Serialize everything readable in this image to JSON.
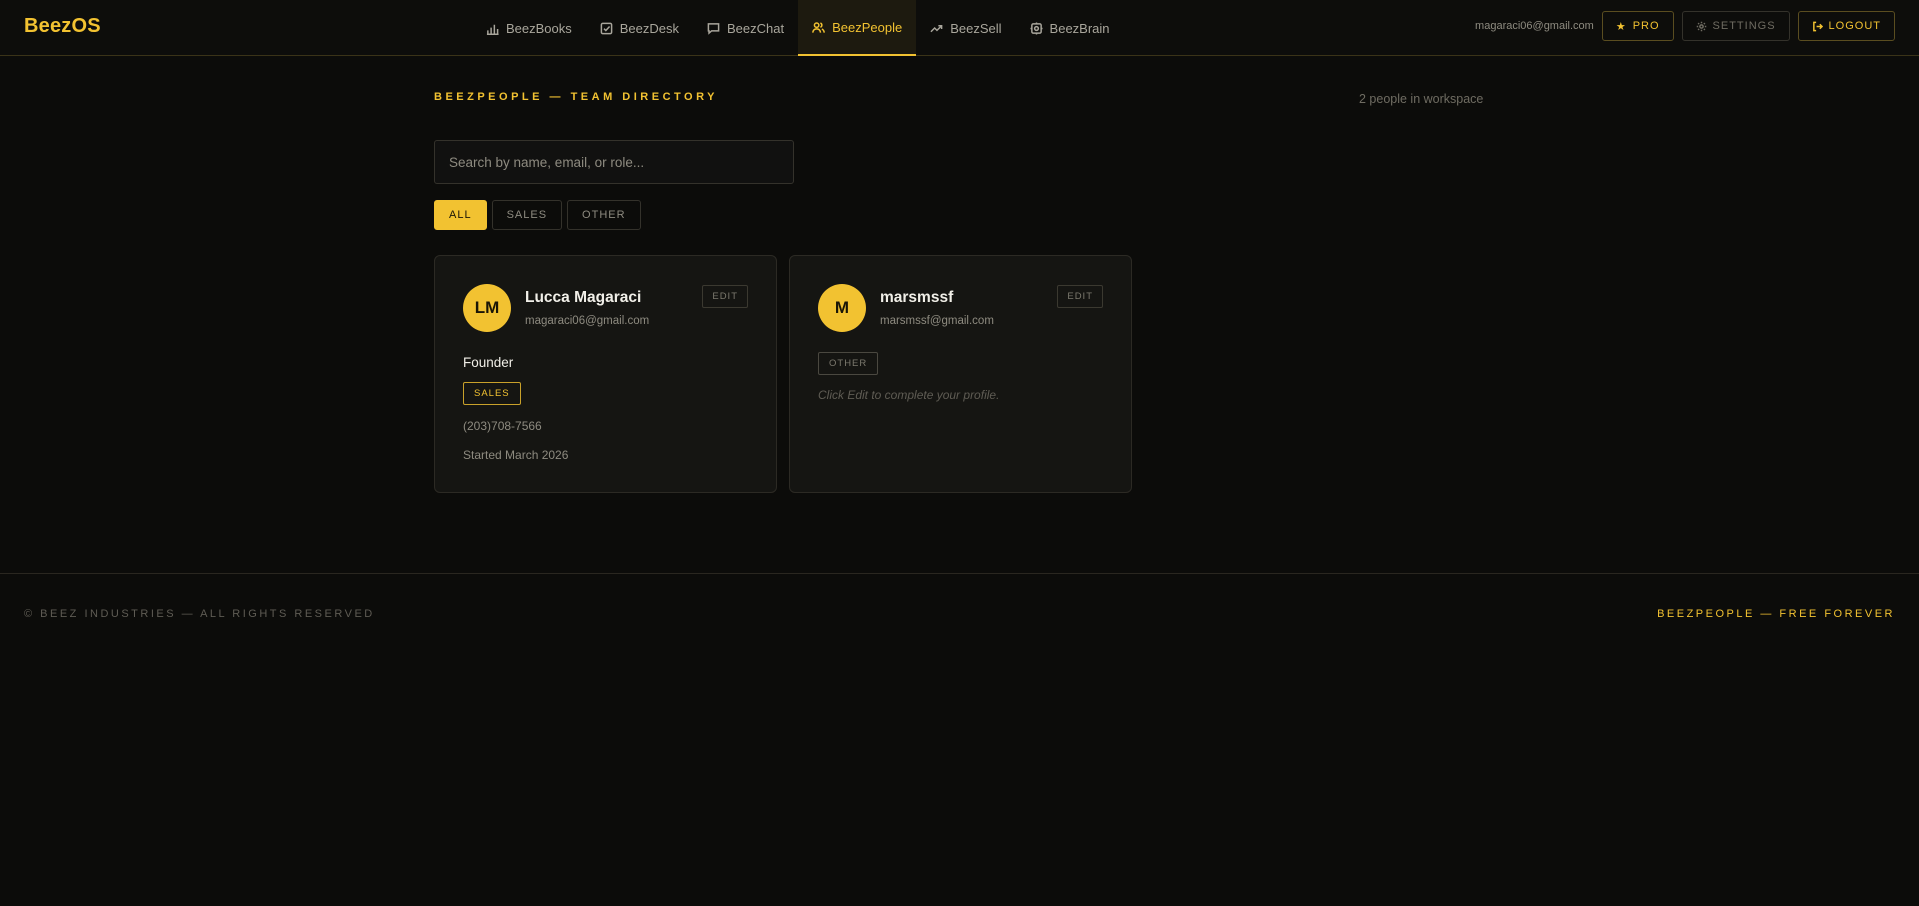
{
  "header": {
    "logo": "BeezOS",
    "nav": [
      {
        "label": "BeezBooks",
        "icon": "bar-chart-icon"
      },
      {
        "label": "BeezDesk",
        "icon": "check-square-icon"
      },
      {
        "label": "BeezChat",
        "icon": "chat-bubble-icon"
      },
      {
        "label": "BeezPeople",
        "icon": "users-icon",
        "active": true
      },
      {
        "label": "BeezSell",
        "icon": "trending-up-icon"
      },
      {
        "label": "BeezBrain",
        "icon": "brain-chip-icon"
      }
    ],
    "user_email": "magaraci06@gmail.com",
    "pro_label": "PRO",
    "settings_label": "SETTINGS",
    "logout_label": "LOGOUT"
  },
  "main": {
    "title": "BEEZPEOPLE — TEAM DIRECTORY",
    "count": "2 people in workspace",
    "search_placeholder": "Search by name, email, or role...",
    "filters": [
      {
        "label": "ALL",
        "active": true
      },
      {
        "label": "SALES",
        "active": false
      },
      {
        "label": "OTHER",
        "active": false
      }
    ],
    "people": [
      {
        "initials": "LM",
        "name": "Lucca Magaraci",
        "email": "magaraci06@gmail.com",
        "edit_label": "EDIT",
        "role": "Founder",
        "tag": "SALES",
        "phone": "(203)708-7566",
        "started": "Started March 2026"
      },
      {
        "initials": "M",
        "name": "marsmssf",
        "email": "marsmssf@gmail.com",
        "edit_label": "EDIT",
        "tag": "OTHER",
        "hint": "Click Edit to complete your profile."
      }
    ]
  },
  "footer": {
    "copyright": "© BEEZ INDUSTRIES — ALL RIGHTS RESERVED",
    "tagline": "BEEZPEOPLE — FREE FOREVER"
  },
  "colors": {
    "accent": "#f2c231",
    "background": "#0c0c0a",
    "card": "#151512"
  }
}
